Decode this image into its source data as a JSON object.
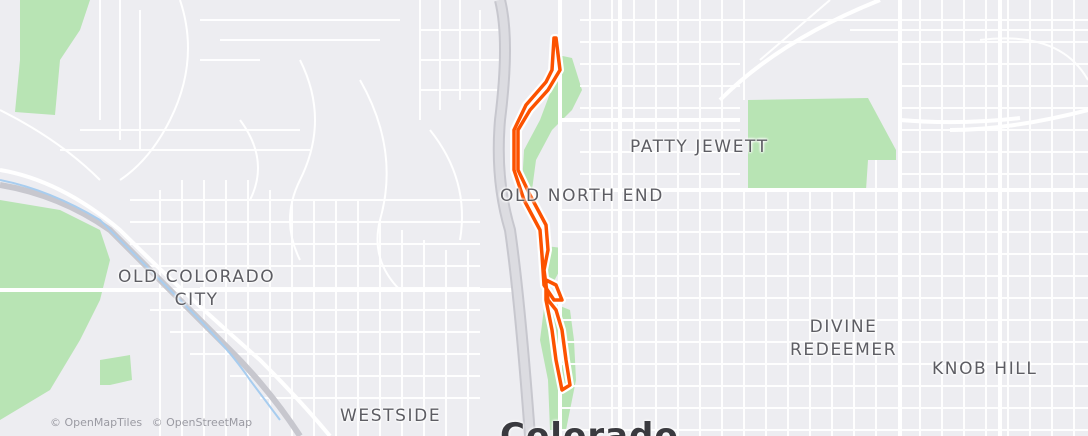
{
  "map": {
    "labels": {
      "patty_jewett": "PATTY JEWETT",
      "old_north_end": "OLD NORTH END",
      "old_colorado_city_line1": "OLD COLORADO",
      "old_colorado_city_line2": "CITY",
      "westside": "WESTSIDE",
      "divine_redeemer_line1": "DIVINE",
      "divine_redeemer_line2": "REDEEMER",
      "knob_hill": "KNOB HILL",
      "colorado": "Colorado"
    },
    "attribution": {
      "mapbox": "© OpenMapTiles",
      "osm": "© OpenStreetMap"
    },
    "colors": {
      "background": "#ededf1",
      "park": "#b7e5b4",
      "road": "#ffffff",
      "highway": "#c9c9cf",
      "route": "#fc5200",
      "water": "#9cc9f0"
    }
  }
}
